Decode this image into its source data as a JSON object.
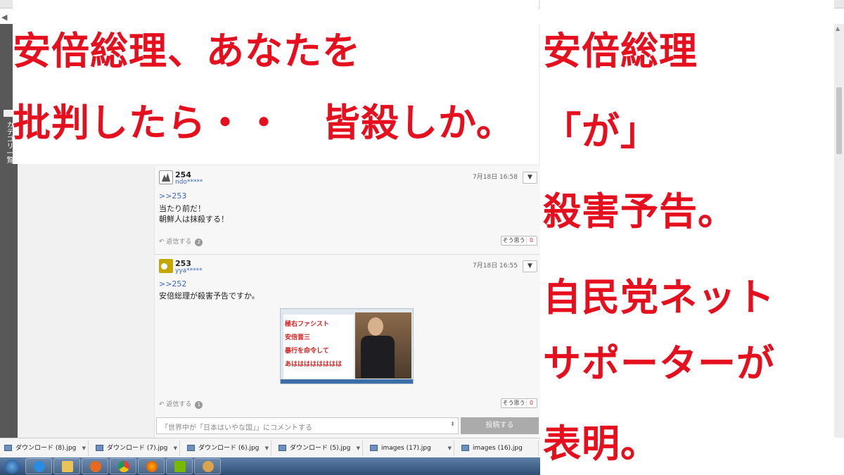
{
  "overlay": {
    "left_lines": [
      "安倍総理、あなたを",
      "批判したら・・　皆殺しか。"
    ],
    "right_lines": [
      "安倍総理",
      "「が」",
      "殺害予告。",
      "自民党ネット",
      "サポーターが",
      "表明。"
    ]
  },
  "sidebar": {
    "vertical_label": "カテゴリ一覧"
  },
  "comments": [
    {
      "number": "254",
      "user": "ndo*****",
      "date": "7月18日 16:58",
      "anchor": ">>253",
      "lines": [
        "当たり前だ！",
        "朝鮮人は抹殺する！"
      ],
      "reply_label": "返信する",
      "reply_count": "2",
      "agree_label": "そう思う",
      "agree_count": "0"
    },
    {
      "number": "253",
      "user": "yya*****",
      "date": "7月18日 16:55",
      "anchor": ">>252",
      "lines": [
        "安倍総理が殺害予告ですか。"
      ],
      "image_text": [
        "極右ファシスト",
        "安倍晋三",
        "暴行を命令して",
        "あはははははははは"
      ],
      "reply_label": "返信する",
      "reply_count": "1",
      "agree_label": "そう思う",
      "agree_count": "0"
    }
  ],
  "comment_box": {
    "placeholder": "「世界中が「日本はいやな国」」にコメントする",
    "post_label": "投稿する"
  },
  "downloads": [
    "ダウンロード (8).jpg",
    "ダウンロード (7).jpg",
    "ダウンロード (6).jpg",
    "ダウンロード (5).jpg",
    "images (17).jpg",
    "images (16).jpg"
  ],
  "colors": {
    "caption_red": "#e60f1e",
    "link_blue": "#3a66c4"
  },
  "taskbar_icons": [
    "ie-icon",
    "explorer-icon",
    "media-player-icon",
    "chrome-icon",
    "firefox-icon",
    "nvidia-icon",
    "paint-icon"
  ]
}
